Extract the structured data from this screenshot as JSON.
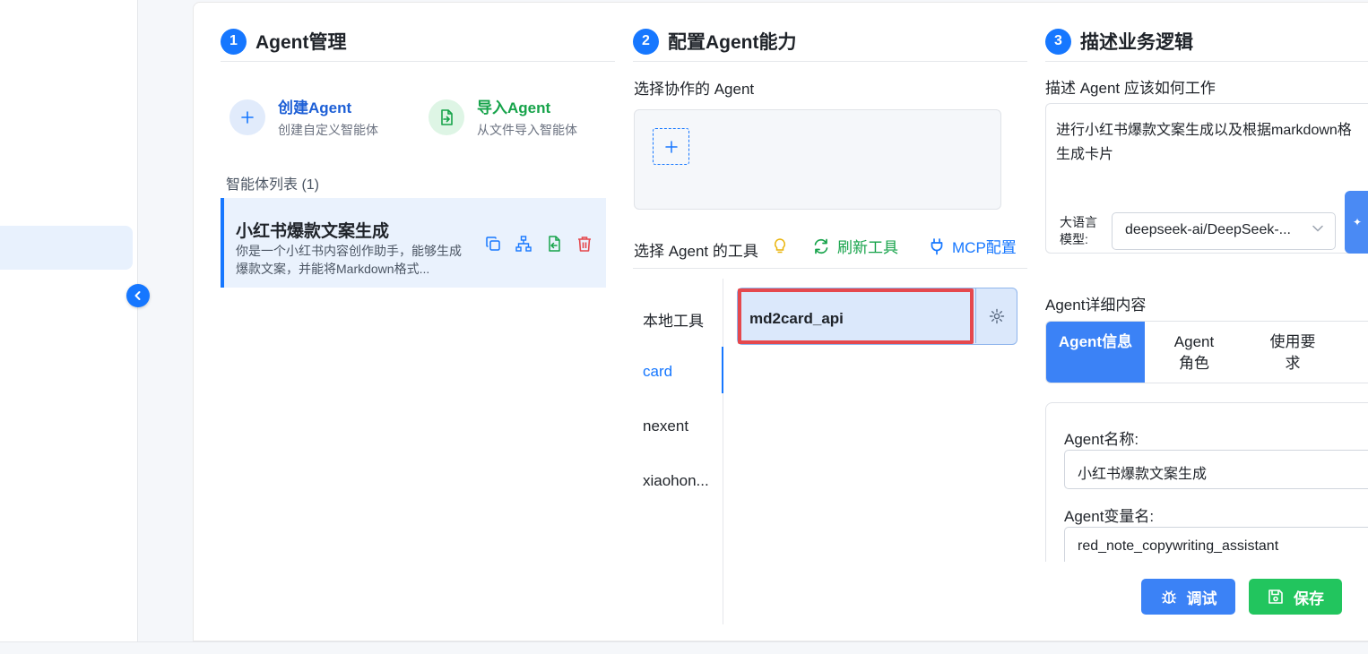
{
  "steps": [
    {
      "num": "1",
      "title": "Agent管理"
    },
    {
      "num": "2",
      "title": "配置Agent能力"
    },
    {
      "num": "3",
      "title": "描述业务逻辑"
    }
  ],
  "agent_management": {
    "create": {
      "title": "创建Agent",
      "subtitle": "创建自定义智能体"
    },
    "import": {
      "title": "导入Agent",
      "subtitle": "从文件导入智能体"
    },
    "list_title": "智能体列表 (1)",
    "agents": [
      {
        "name": "小红书爆款文案生成",
        "desc": "你是一个小红书内容创作助手，能够生成爆款文案，并能将Markdown格式..."
      }
    ]
  },
  "capabilities": {
    "collab_label": "选择协作的 Agent",
    "tools_label": "选择 Agent 的工具",
    "refresh_label": "刷新工具",
    "mcp_label": "MCP配置",
    "categories": [
      "本地工具",
      "card",
      "nexent",
      "xiaohon..."
    ],
    "active_category": "card",
    "tools": [
      {
        "name": "md2card_api"
      }
    ]
  },
  "business_logic": {
    "desc_label": "描述 Agent 应该如何工作",
    "desc_line1": "进行小红书爆款文案生成以及根据markdown格",
    "desc_line2": "生成卡片",
    "model_label": "大语言模型:",
    "model_value": "deepseek-ai/DeepSeek-...",
    "detail_label": "Agent详细内容",
    "tabs": [
      "Agent信息",
      "Agent角色",
      "使用要求"
    ],
    "active_tab": "Agent信息",
    "name_label": "Agent名称:",
    "name_value": "小红书爆款文案生成",
    "var_label": "Agent变量名:",
    "var_value": "red_note_copywriting_assistant",
    "debug_button": "调试",
    "save_button": "保存"
  },
  "colors": {
    "accent": "#1677ff",
    "green": "#16a34a",
    "red": "#e5484d",
    "save": "#22c55e"
  }
}
